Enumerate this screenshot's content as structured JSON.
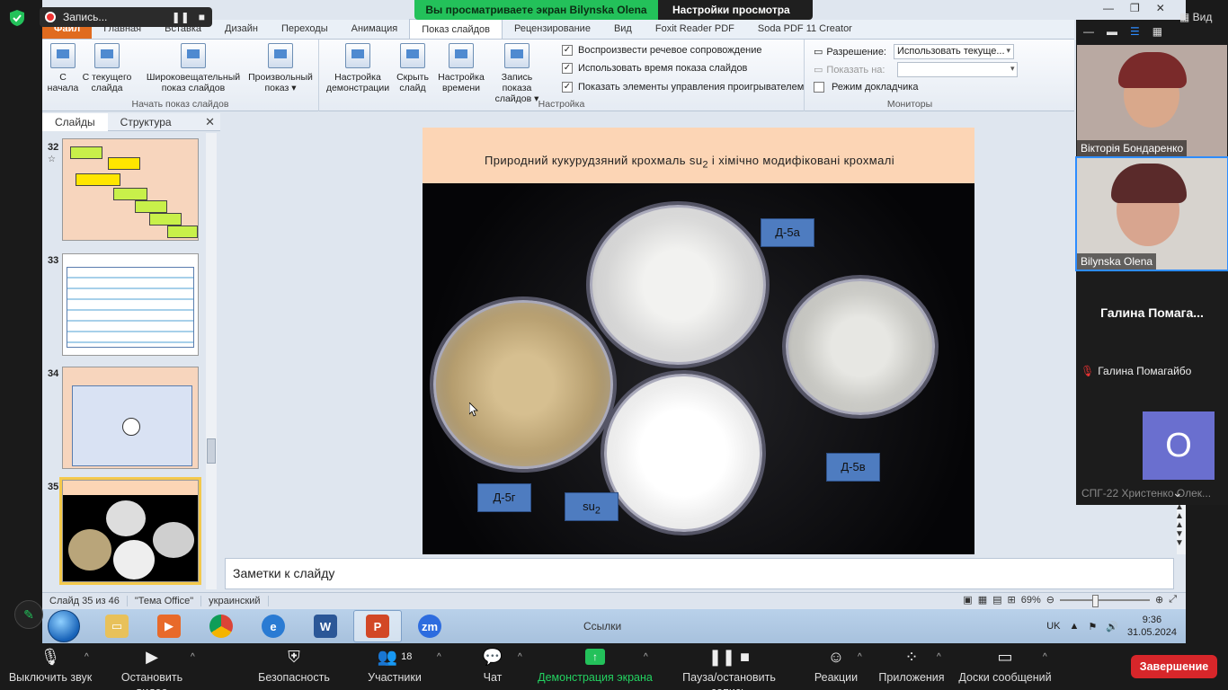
{
  "zoom": {
    "recording_label": "Запись...",
    "share_banner": "Вы просматриваете экран Bilynska Olena",
    "view_settings": "Настройки просмотра",
    "view_menu": "Вид",
    "end_button": "Завершение",
    "toolbar": [
      {
        "label": "Выключить звук",
        "icon": "mic-icon"
      },
      {
        "label": "Остановить видео",
        "icon": "camera-icon"
      },
      {
        "label": "Безопасность",
        "icon": "shield-icon"
      },
      {
        "label": "Участники",
        "icon": "participants-icon",
        "count": "18"
      },
      {
        "label": "Чат",
        "icon": "chat-icon"
      },
      {
        "label": "Демонстрация экрана",
        "icon": "share-screen-icon"
      },
      {
        "label": "Пауза/остановить запись",
        "icon": "pause-stop-icon"
      },
      {
        "label": "Реакции",
        "icon": "reaction-icon"
      },
      {
        "label": "Приложения",
        "icon": "apps-icon"
      },
      {
        "label": "Доски сообщений",
        "icon": "whiteboard-icon"
      }
    ],
    "participants": {
      "p1": "Вікторія Бондаренко",
      "p2": "Bilynska Olena",
      "p3_display": "Галина  Помага...",
      "p3_name": "Галина Помагайбо",
      "p4_avatar": "O",
      "p5": "СПГ-22 Христенко Олек..."
    }
  },
  "ppt": {
    "tabs": [
      "Файл",
      "Главная",
      "Вставка",
      "Дизайн",
      "Переходы",
      "Анимация",
      "Показ слайдов",
      "Рецензирование",
      "Вид",
      "Foxit Reader PDF",
      "Soda PDF 11 Creator"
    ],
    "active_tab": "Показ слайдов",
    "groups": {
      "start": {
        "label": "Начать показ слайдов",
        "buttons": [
          "С начала",
          "С текущего слайда",
          "Широковещательный показ слайдов",
          "Произвольный показ"
        ]
      },
      "setup": {
        "label": "Настройка",
        "buttons": [
          "Настройка демонстрации",
          "Скрыть слайд",
          "Настройка времени",
          "Запись показа слайдов"
        ],
        "checks": [
          {
            "label": "Воспроизвести речевое сопровождение",
            "checked": true
          },
          {
            "label": "Использовать время показа слайдов",
            "checked": true
          },
          {
            "label": "Показать элементы управления проигрывателем",
            "checked": true
          }
        ]
      },
      "monitors": {
        "label": "Мониторы",
        "resolution_label": "Разрешение:",
        "resolution_value": "Использовать текуще...",
        "show_on_label": "Показать на:",
        "show_on_value": "",
        "presenter_mode": "Режим докладчика"
      }
    },
    "panel_tabs": [
      "Слайды",
      "Структура"
    ],
    "thumbnails": [
      "32",
      "33",
      "34",
      "35"
    ],
    "selected_slide": "35",
    "slide": {
      "title_main": "Природний  кукурудзяний  крохмаль su",
      "title_sub": "2",
      "title_rest": "  і хімічно модифіковані крохмалі",
      "labels": {
        "d5a": "Д-5а",
        "d5v": "Д-5в",
        "d5g": "Д-5г",
        "su": "su",
        "su_sub": "2"
      }
    },
    "notes_placeholder": "Заметки к слайду",
    "status": {
      "slide_info": "Слайд 35 из 46",
      "theme": "\"Тема Office\"",
      "language": "украинский",
      "zoom": "69%"
    }
  },
  "taskbar": {
    "apps": [
      "Проводник",
      "Media",
      "Chrome",
      "IE",
      "Word",
      "PowerPoint",
      "Zoom"
    ],
    "links": "Ссылки",
    "lang": "UK",
    "time": "9:36",
    "date": "31.05.2024"
  }
}
